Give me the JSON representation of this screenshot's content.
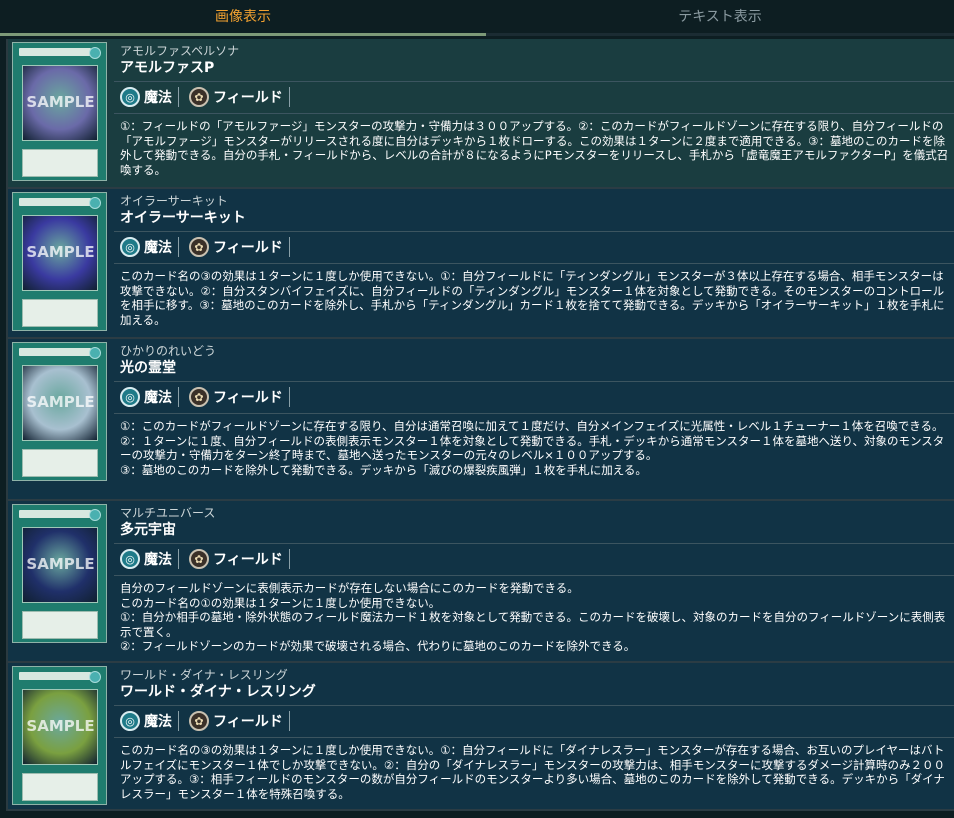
{
  "tabs": {
    "image_view": "画像表示",
    "text_view": "テキスト表示"
  },
  "cards": [
    {
      "ruby": "アモルファスペルソナ",
      "name": "アモルファスP",
      "thumb_label": "アモルファスP",
      "art_color": "#6a6aa8",
      "sample": "SAMPLE",
      "tag_type": "魔法",
      "tag_sub": "フィールド",
      "desc": [
        "①：フィールドの「アモルファージ」モンスターの攻撃力・守備力は３００アップする。②：このカードがフィールドゾーンに存在する限り、自分フィールドの「アモルファージ」モンスターがリリースされる度に自分はデッキから１枚ドローする。この効果は１ターンに２度まで適用できる。③：墓地のこのカードを除外して発動できる。自分の手札・フィールドから、レベルの合計が８になるようにPモンスターをリリースし、手札から「虚竜魔王アモルファクターP」を儀式召喚する。"
      ]
    },
    {
      "ruby": "オイラーサーキット",
      "name": "オイラーサーキット",
      "thumb_label": "オイラーサーキット",
      "art_color": "#3a3aa0",
      "sample": "SAMPLE",
      "tag_type": "魔法",
      "tag_sub": "フィールド",
      "desc": [
        "このカード名の③の効果は１ターンに１度しか使用できない。①：自分フィールドに「ティンダングル」モンスターが３体以上存在する場合、相手モンスターは攻撃できない。②：自分スタンバイフェイズに、自分フィールドの「ティンダングル」モンスター１体を対象として発動できる。そのモンスターのコントロールを相手に移す。③：墓地のこのカードを除外し、手札から「ティンダングル」カード１枚を捨てて発動できる。デッキから「オイラーサーキット」１枚を手札に加える。"
      ]
    },
    {
      "ruby": "ひかりのれいどう",
      "name": "光の霊堂",
      "thumb_label": "光の霊堂",
      "art_color": "#a8c0d0",
      "sample": "SAMPLE",
      "tag_type": "魔法",
      "tag_sub": "フィールド",
      "desc": [
        "①：このカードがフィールドゾーンに存在する限り、自分は通常召喚に加えて１度だけ、自分メインフェイズに光属性・レベル１チューナー１体を召喚できる。",
        "②：１ターンに１度、自分フィールドの表側表示モンスター１体を対象として発動できる。手札・デッキから通常モンスター１体を墓地へ送り、対象のモンスターの攻撃力・守備力をターン終了時まで、墓地へ送ったモンスターの元々のレベル×１００アップする。",
        "③：墓地のこのカードを除外して発動できる。デッキから「滅びの爆裂疾風弾」１枚を手札に加える。"
      ]
    },
    {
      "ruby": "マルチユニバース",
      "name": "多元宇宙",
      "thumb_label": "多元宇宙",
      "art_color": "#20306a",
      "sample": "SAMPLE",
      "tag_type": "魔法",
      "tag_sub": "フィールド",
      "desc": [
        "自分のフィールドゾーンに表側表示カードが存在しない場合にこのカードを発動できる。",
        "このカード名の①の効果は１ターンに１度しか使用できない。",
        "①：自分か相手の墓地・除外状態のフィールド魔法カード１枚を対象として発動できる。このカードを破壊し、対象のカードを自分のフィールドゾーンに表側表示で置く。",
        "②：フィールドゾーンのカードが効果で破壊される場合、代わりに墓地のこのカードを除外できる。"
      ]
    },
    {
      "ruby": "ワールド・ダイナ・レスリング",
      "name": "ワールド・ダイナ・レスリング",
      "thumb_label": "ワールド・ダイナ・レスリング",
      "art_color": "#7aa040",
      "sample": "SAMPLE",
      "tag_type": "魔法",
      "tag_sub": "フィールド",
      "desc": [
        "このカード名の③の効果は１ターンに１度しか使用できない。①：自分フィールドに「ダイナレスラー」モンスターが存在する場合、お互いのプレイヤーはバトルフェイズにモンスター１体でしか攻撃できない。②：自分の「ダイナレスラー」モンスターの攻撃力は、相手モンスターに攻撃するダメージ計算時のみ２００アップする。③：相手フィールドのモンスターの数が自分フィールドのモンスターより多い場合、墓地のこのカードを除外して発動できる。デッキから「ダイナレスラー」モンスター１体を特殊召喚する。"
      ]
    }
  ]
}
